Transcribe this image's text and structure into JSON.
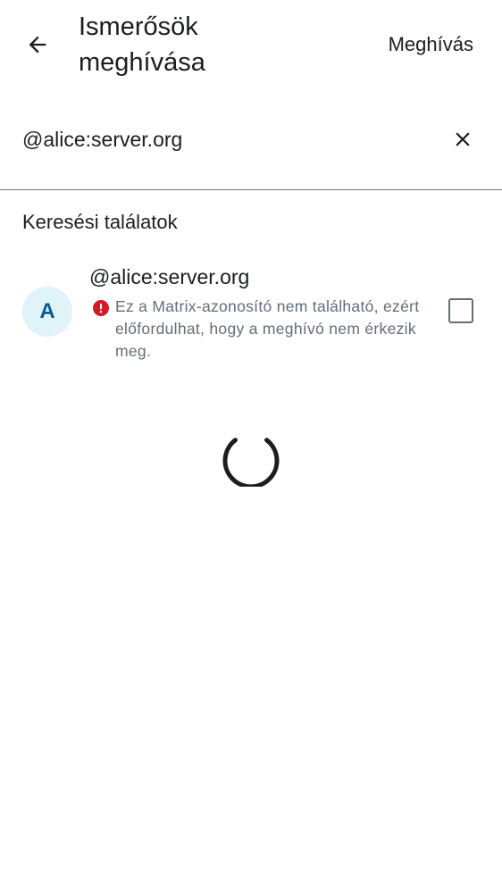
{
  "header": {
    "title_line1": "Ismerősök",
    "title_line2": "meghívása",
    "invite_label": "Meghívás",
    "back_icon": "arrow-left-icon"
  },
  "search": {
    "value": "@alice:server.org",
    "placeholder": "",
    "clear_icon": "close-icon"
  },
  "results": {
    "header": "Keresési találatok",
    "items": [
      {
        "avatar_letter": "A",
        "name": "@alice:server.org",
        "warning": "Ez a Matrix-azonosító nem található, ezért előfordulhat, hogy a meghívó nem érkezik meg.",
        "warning_icon": "error-icon",
        "checked": false
      }
    ]
  },
  "loading": {
    "spinner_icon": "loading-spinner-icon"
  },
  "colors": {
    "text_primary": "#1b1d22",
    "text_secondary": "#656d77",
    "avatar_bg": "#e0f3f8",
    "avatar_fg": "#0e5a8a",
    "error": "#d51928",
    "divider": "#6f7075"
  }
}
